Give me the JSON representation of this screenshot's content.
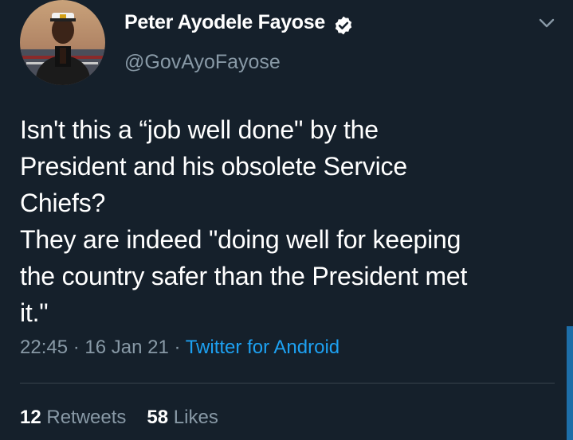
{
  "user": {
    "display_name": "Peter Ayodele Fayose",
    "handle": "@GovAyoFayose",
    "verified": true,
    "avatar_icon": "profile-photo"
  },
  "tweet": {
    "lines": [
      "Isn't this a “job well done\" by the",
      "President and his obsolete Service",
      "Chiefs?",
      "They are indeed \"doing well for keeping",
      "the country safer than the President met",
      "it.\""
    ]
  },
  "meta": {
    "time": "22:45",
    "sep1": " · ",
    "date": "16 Jan 21",
    "sep2": " · ",
    "source": "Twitter for Android"
  },
  "stats": {
    "retweets_count": "12",
    "retweets_label": "Retweets",
    "likes_count": "58",
    "likes_label": "Likes"
  },
  "colors": {
    "background": "#15202b",
    "text": "#ffffff",
    "secondary": "#8899a6",
    "accent": "#1da1f2",
    "divider": "#38444d"
  },
  "icons": {
    "verified": "verified-badge-icon",
    "menu": "chevron-down-icon"
  }
}
